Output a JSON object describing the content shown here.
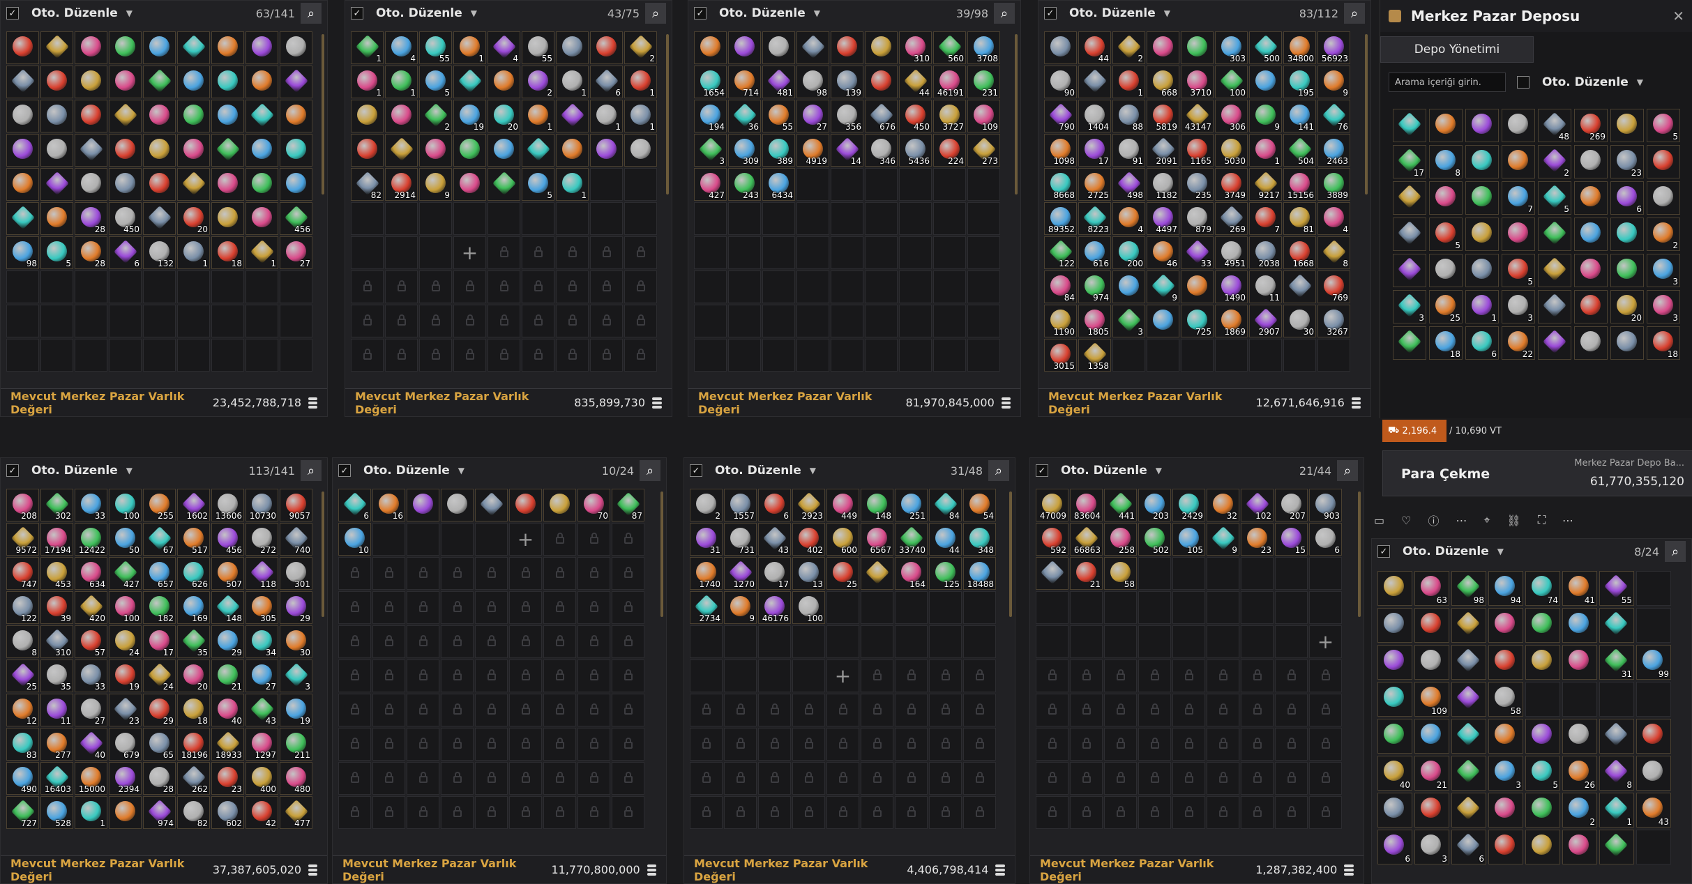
{
  "panels": [
    {
      "sort_label": "Oto. Düzenle",
      "count": "63/141",
      "footer_label": "Mevcut Merkez Pazar Varlık Değeri",
      "footer_value": "23,452,788,718",
      "cols": 9,
      "rows": 11,
      "items": [
        "",
        "",
        "",
        "",
        "",
        "",
        "",
        "",
        "",
        "",
        "",
        "",
        "",
        "",
        "",
        "",
        "",
        "",
        "",
        "",
        "",
        "",
        "",
        "",
        "",
        "",
        "",
        "",
        "",
        "",
        "",
        "",
        "",
        "",
        "",
        "",
        "",
        "",
        "",
        "",
        "",
        "",
        "",
        "",
        "",
        "",
        "",
        "28",
        "450",
        "",
        "20",
        "",
        "",
        "456",
        "98",
        "5",
        "28",
        "6",
        "132",
        "1",
        "18",
        "1",
        "27"
      ],
      "filled": 63,
      "plus": -1,
      "locked_from": -1
    },
    {
      "sort_label": "Oto. Düzenle",
      "count": "43/75",
      "footer_label": "Mevcut Merkez Pazar Varlık Değeri",
      "footer_value": "835,899,730",
      "cols": 9,
      "rows": 11,
      "items": [
        "1",
        "4",
        "55",
        "1",
        "4",
        "55",
        "",
        "",
        "2",
        "1",
        "1",
        "5",
        "",
        "",
        "2",
        "1",
        "6",
        "1",
        "",
        "",
        "2",
        "19",
        "20",
        "1",
        "",
        "1",
        "1",
        "",
        "",
        "",
        "",
        "",
        "",
        "",
        "",
        "",
        "82",
        "2914",
        "9",
        "",
        "",
        "5",
        "1"
      ],
      "filled": 43,
      "plus": 57,
      "locked_from": 58
    },
    {
      "sort_label": "Oto. Düzenle",
      "count": "39/98",
      "footer_label": "Mevcut Merkez Pazar Varlık Değeri",
      "footer_value": "81,970,845,000",
      "cols": 9,
      "rows": 11,
      "items": [
        "",
        "",
        "",
        "",
        "",
        "",
        "310",
        "560",
        "3708",
        "1654",
        "714",
        "481",
        "98",
        "139",
        "",
        "44",
        "46191",
        "231",
        "194",
        "36",
        "55",
        "27",
        "356",
        "676",
        "450",
        "3727",
        "109",
        "3",
        "309",
        "389",
        "4919",
        "14",
        "346",
        "5436",
        "224",
        "273",
        "427",
        "243",
        "6434"
      ],
      "filled": 39,
      "plus": -1,
      "locked_from": -1
    },
    {
      "sort_label": "Oto. Düzenle",
      "count": "83/112",
      "footer_label": "Mevcut Merkez Pazar Varlık Değeri",
      "footer_value": "12,671,646,916",
      "cols": 9,
      "rows": 11,
      "items": [
        "",
        "44",
        "2",
        "",
        "",
        "303",
        "500",
        "34800",
        "56923",
        "90",
        "",
        "1",
        "668",
        "3710",
        "100",
        "",
        "195",
        "9",
        "790",
        "1404",
        "88",
        "5819",
        "43147",
        "306",
        "9",
        "141",
        "76",
        "1098",
        "17",
        "91",
        "2091",
        "1165",
        "5030",
        "1",
        "504",
        "2463",
        "8668",
        "2725",
        "498",
        "1182",
        "235",
        "3749",
        "9217",
        "15156",
        "3889",
        "89352",
        "8223",
        "4",
        "4497",
        "879",
        "269",
        "7",
        "81",
        "4",
        "122",
        "616",
        "200",
        "46",
        "33",
        "4951",
        "2038",
        "1668",
        "8",
        "84",
        "974",
        "",
        "9",
        "",
        "1490",
        "11",
        "",
        "769",
        "1190",
        "1805",
        "3",
        "",
        "725",
        "1869",
        "2907",
        "30",
        "3267",
        "3015",
        "1358"
      ],
      "filled": 83,
      "plus": -1,
      "locked_from": -1
    },
    {
      "sort_label": "Oto. Düzenle",
      "count": "113/141",
      "footer_label": "Mevcut Merkez Pazar Varlık Değeri",
      "footer_value": "37,387,605,020",
      "cols": 9,
      "rows": 11,
      "items": [
        "208",
        "302",
        "33",
        "100",
        "255",
        "1602",
        "13606",
        "10730",
        "9057",
        "9572",
        "17194",
        "12422",
        "50",
        "67",
        "517",
        "456",
        "272",
        "740",
        "747",
        "453",
        "634",
        "427",
        "657",
        "626",
        "507",
        "118",
        "301",
        "122",
        "39",
        "420",
        "100",
        "182",
        "169",
        "148",
        "305",
        "29",
        "8",
        "310",
        "57",
        "24",
        "17",
        "35",
        "29",
        "34",
        "30",
        "25",
        "35",
        "33",
        "19",
        "24",
        "20",
        "21",
        "27",
        "3",
        "12",
        "11",
        "27",
        "23",
        "29",
        "18",
        "40",
        "43",
        "19",
        "83",
        "277",
        "40",
        "679",
        "65",
        "18196",
        "18933",
        "1297",
        "211",
        "490",
        "16403",
        "15000",
        "2394",
        "28",
        "262",
        "23",
        "400",
        "480",
        "727",
        "528",
        "1",
        "",
        "974",
        "82",
        "602",
        "42",
        "477"
      ],
      "filled": 90,
      "plus": -1,
      "locked_from": -1
    },
    {
      "sort_label": "Oto. Düzenle",
      "count": "10/24",
      "footer_label": "Mevcut Merkez Pazar Varlık Değeri",
      "footer_value": "11,770,800,000",
      "cols": 9,
      "rows": 11,
      "items": [
        "6",
        "16",
        "",
        "",
        "",
        "",
        "",
        "70",
        "87",
        "10"
      ],
      "filled": 10,
      "plus": 14,
      "locked_from": 15
    },
    {
      "sort_label": "Oto. Düzenle",
      "count": "31/48",
      "footer_label": "Mevcut Merkez Pazar Varlık Değeri",
      "footer_value": "4,406,798,414",
      "cols": 9,
      "rows": 11,
      "items": [
        "2",
        "1557",
        "6",
        "2923",
        "449",
        "148",
        "251",
        "84",
        "54",
        "31",
        "731",
        "43",
        "402",
        "600",
        "6567",
        "33740",
        "44",
        "348",
        "1740",
        "1270",
        "17",
        "13",
        "25",
        "",
        "164",
        "125",
        "18488",
        "2734",
        "9",
        "46176",
        "100"
      ],
      "filled": 31,
      "plus": 49,
      "locked_from": 50
    },
    {
      "sort_label": "Oto. Düzenle",
      "count": "21/44",
      "footer_label": "Mevcut Merkez Pazar Varlık Değeri",
      "footer_value": "1,287,382,400",
      "cols": 9,
      "rows": 11,
      "items": [
        "47009",
        "83604",
        "441",
        "203",
        "2429",
        "32",
        "102",
        "207",
        "903",
        "592",
        "66863",
        "258",
        "502",
        "105",
        "9",
        "23",
        "15",
        "6",
        "",
        "21",
        "58"
      ],
      "filled": 21,
      "plus": 44,
      "locked_from": 45
    }
  ],
  "depot": {
    "title": "Merkez Pazar Deposu",
    "tab": "Depo Yönetimi",
    "search_placeholder": "Arama içeriği girin.",
    "sort_label": "Oto. Düzenle",
    "items": [
      "",
      "",
      "",
      "",
      "48",
      "269",
      "",
      "5",
      "17",
      "8",
      "",
      "",
      "2",
      "",
      "23",
      "",
      "",
      "",
      "",
      "7",
      "5",
      "",
      "6",
      "",
      "",
      "5",
      "",
      "",
      "",
      "",
      "",
      "2",
      "",
      "",
      "",
      "5",
      "",
      "",
      "",
      "3",
      "3",
      "25",
      "1",
      "3",
      "",
      "",
      "20",
      "3",
      "",
      "18",
      "6",
      "22",
      "",
      "",
      "",
      "18",
      "",
      "",
      "",
      "",
      "",
      "",
      "",
      ""
    ],
    "weight_used": "2,196.4",
    "weight_total": "/ 10,690 VT",
    "withdraw_label": "Para Çekme",
    "depot_balance_label": "Merkez Pazar Depo Ba...",
    "depot_balance": "61,770,355,120"
  },
  "bottom_right": {
    "sort_label": "Oto. Düzenle",
    "count": "8/24",
    "items": [
      "",
      "63",
      "98",
      "94",
      "74",
      "41",
      "55",
      "",
      "",
      "",
      "",
      "",
      "",
      "",
      "",
      "",
      "",
      "",
      "",
      "",
      "",
      "",
      "31",
      "99",
      "",
      "109",
      "",
      "58",
      "",
      "",
      "",
      "",
      "",
      "",
      "",
      "",
      "",
      "",
      "",
      "",
      "40",
      "21",
      "",
      "3",
      "5",
      "26",
      "8",
      "",
      "",
      "",
      "",
      "",
      "",
      "2",
      "1",
      "43",
      "6",
      "3",
      "6",
      "",
      "",
      "",
      "",
      ""
    ]
  }
}
